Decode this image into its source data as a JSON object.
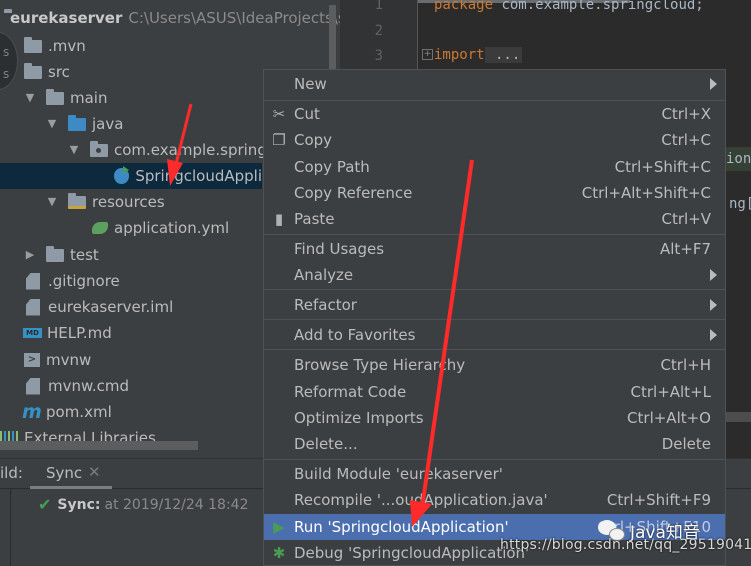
{
  "project_tree": {
    "root": {
      "name": "eurekaserver",
      "path": "C:\\Users\\ASUS\\IdeaProjects\\s"
    },
    "items": [
      {
        "label": ".mvn",
        "icon": "folder-icon",
        "expanded": null
      },
      {
        "label": "src",
        "icon": "folder-icon",
        "expanded": null
      },
      {
        "label": "main",
        "icon": "folder-icon",
        "expanded": true
      },
      {
        "label": "java",
        "icon": "source-folder-icon",
        "expanded": true
      },
      {
        "label": "com.example.springc",
        "icon": "package-icon",
        "expanded": true
      },
      {
        "label": "SpringcloudAppli",
        "icon": "spring-boot-class-icon",
        "selected": true
      },
      {
        "label": "resources",
        "icon": "resources-folder-icon",
        "expanded": true
      },
      {
        "label": "application.yml",
        "icon": "spring-config-icon"
      },
      {
        "label": "test",
        "icon": "folder-icon",
        "expanded": false
      },
      {
        "label": ".gitignore",
        "icon": "ignore-file-icon"
      },
      {
        "label": "eurekaserver.iml",
        "icon": "module-file-icon"
      },
      {
        "label": "HELP.md",
        "icon": "markdown-file-icon"
      },
      {
        "label": "mvnw",
        "icon": "shell-script-icon"
      },
      {
        "label": "mvnw.cmd",
        "icon": "text-file-icon"
      },
      {
        "label": "pom.xml",
        "icon": "maven-icon"
      },
      {
        "label": "External Libraries",
        "icon": "libraries-icon"
      }
    ]
  },
  "editor": {
    "line_numbers": [
      "1",
      "2",
      "3"
    ],
    "lines": [
      {
        "keyword": "package",
        "rest": " com.example.springcloud;"
      },
      {
        "keyword": "",
        "rest": ""
      },
      {
        "keyword": "import",
        "rest": " ..."
      }
    ],
    "visible_fragments": [
      "ion",
      "ng["
    ]
  },
  "build_panel": {
    "label": "ild:",
    "tab": "Sync",
    "sync_title": "Sync:",
    "sync_time": "at 2019/12/24 18:42"
  },
  "context_menu": {
    "items": [
      {
        "label": "New",
        "shortcut": "",
        "submenu": true,
        "icon": ""
      },
      {
        "label": "Cut",
        "shortcut": "Ctrl+X",
        "icon": "scissors-icon"
      },
      {
        "label": "Copy",
        "shortcut": "Ctrl+C",
        "icon": "copy-icon"
      },
      {
        "label": "Copy Path",
        "shortcut": "Ctrl+Shift+C"
      },
      {
        "label": "Copy Reference",
        "shortcut": "Ctrl+Alt+Shift+C"
      },
      {
        "label": "Paste",
        "shortcut": "Ctrl+V",
        "icon": "clipboard-icon"
      },
      {
        "label": "Find Usages",
        "shortcut": "Alt+F7"
      },
      {
        "label": "Analyze",
        "shortcut": "",
        "submenu": true
      },
      {
        "label": "Refactor",
        "shortcut": "",
        "submenu": true
      },
      {
        "label": "Add to Favorites",
        "shortcut": "",
        "submenu": true
      },
      {
        "label": "Browse Type Hierarchy",
        "shortcut": "Ctrl+H"
      },
      {
        "label": "Reformat Code",
        "shortcut": "Ctrl+Alt+L"
      },
      {
        "label": "Optimize Imports",
        "shortcut": "Ctrl+Alt+O"
      },
      {
        "label": "Delete...",
        "shortcut": "Delete"
      },
      {
        "label": "Build Module 'eurekaserver'",
        "shortcut": ""
      },
      {
        "label": "Recompile '...oudApplication.java'",
        "shortcut": "Ctrl+Shift+F9"
      },
      {
        "label": "Run 'SpringcloudApplication'",
        "shortcut": "Ctrl+Shift+F10",
        "active": true,
        "icon": "run-icon"
      },
      {
        "label": "Debug 'SpringcloudApplication'",
        "shortcut": "",
        "icon": "debug-icon"
      }
    ]
  },
  "watermarks": {
    "brand": "Java知音",
    "url": "https://blog.csdn.net/qq_29519041"
  },
  "left_dial": {
    "top": "s",
    "bottom": "s"
  },
  "colors": {
    "selection": "#0d293e",
    "menu_highlight": "#4b6eaf",
    "keyword": "#cc7832",
    "annotation_arrow": "#ff2a2a",
    "success": "#499c54"
  }
}
